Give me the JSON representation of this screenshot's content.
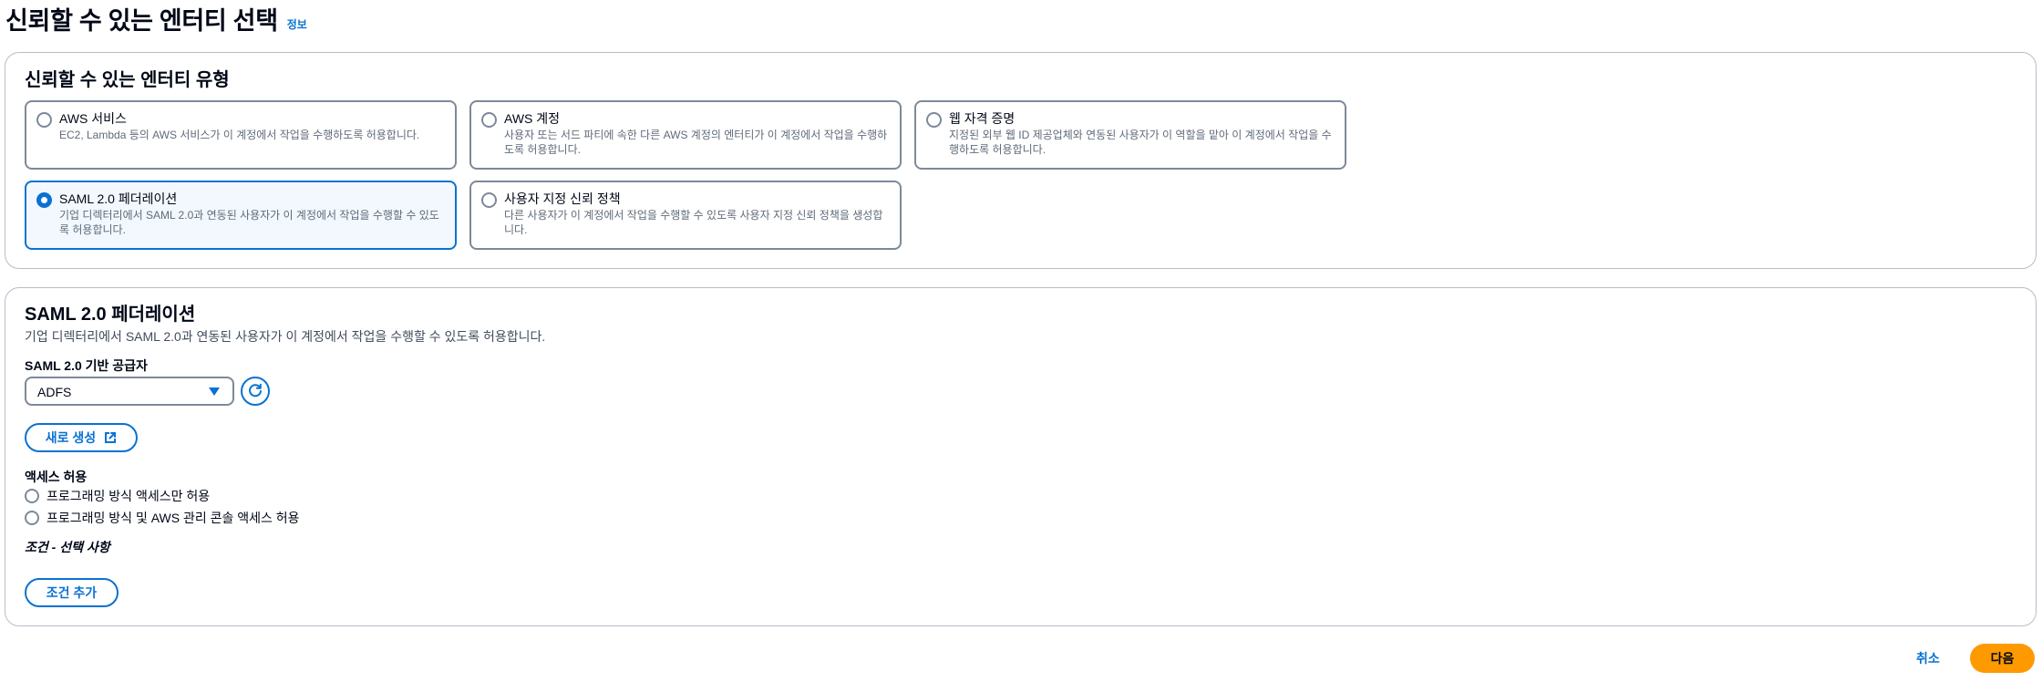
{
  "header": {
    "title": "신뢰할 수 있는 엔터티 선택",
    "info_link": "정보"
  },
  "entity_type": {
    "title": "신뢰할 수 있는 엔터티 유형",
    "options": [
      {
        "label": "AWS 서비스",
        "description": "EC2, Lambda 등의 AWS 서비스가 이 계정에서 작업을 수행하도록 허용합니다.",
        "selected": false
      },
      {
        "label": "AWS 계정",
        "description": "사용자 또는 서드 파티에 속한 다른 AWS 계정의 엔터티가 이 계정에서 작업을 수행하도록 허용합니다.",
        "selected": false
      },
      {
        "label": "웹 자격 증명",
        "description": "지정된 외부 웹 ID 제공업체와 연동된 사용자가 이 역할을 맡아 이 계정에서 작업을 수행하도록 허용합니다.",
        "selected": false
      },
      {
        "label": "SAML 2.0 페더레이션",
        "description": "기업 디렉터리에서 SAML 2.0과 연동된 사용자가 이 계정에서 작업을 수행할 수 있도록 허용합니다.",
        "selected": true
      },
      {
        "label": "사용자 지정 신뢰 정책",
        "description": "다른 사용자가 이 계정에서 작업을 수행할 수 있도록 사용자 지정 신뢰 정책을 생성합니다.",
        "selected": false
      }
    ]
  },
  "saml": {
    "title": "SAML 2.0 페더레이션",
    "description": "기업 디렉터리에서 SAML 2.0과 연동된 사용자가 이 계정에서 작업을 수행할 수 있도록 허용합니다.",
    "provider_label": "SAML 2.0 기반 공급자",
    "provider_value": "ADFS",
    "create_new_label": "새로 생성",
    "access_label": "액세스 허용",
    "access_options": [
      {
        "label": "프로그래밍 방식 액세스만 허용",
        "selected": false
      },
      {
        "label": "프로그래밍 방식 및 AWS 관리 콘솔 액세스 허용",
        "selected": false
      }
    ],
    "condition_title": "조건 - 선택 사항",
    "add_condition_label": "조건 추가"
  },
  "footer": {
    "cancel_label": "취소",
    "next_label": "다음"
  },
  "colors": {
    "accent": "#0972d3",
    "primary_button": "#ff9900",
    "selected_tile_bg": "#f2f8fd"
  },
  "icons": [
    "refresh-icon",
    "external-link-icon",
    "caret-down-icon"
  ]
}
